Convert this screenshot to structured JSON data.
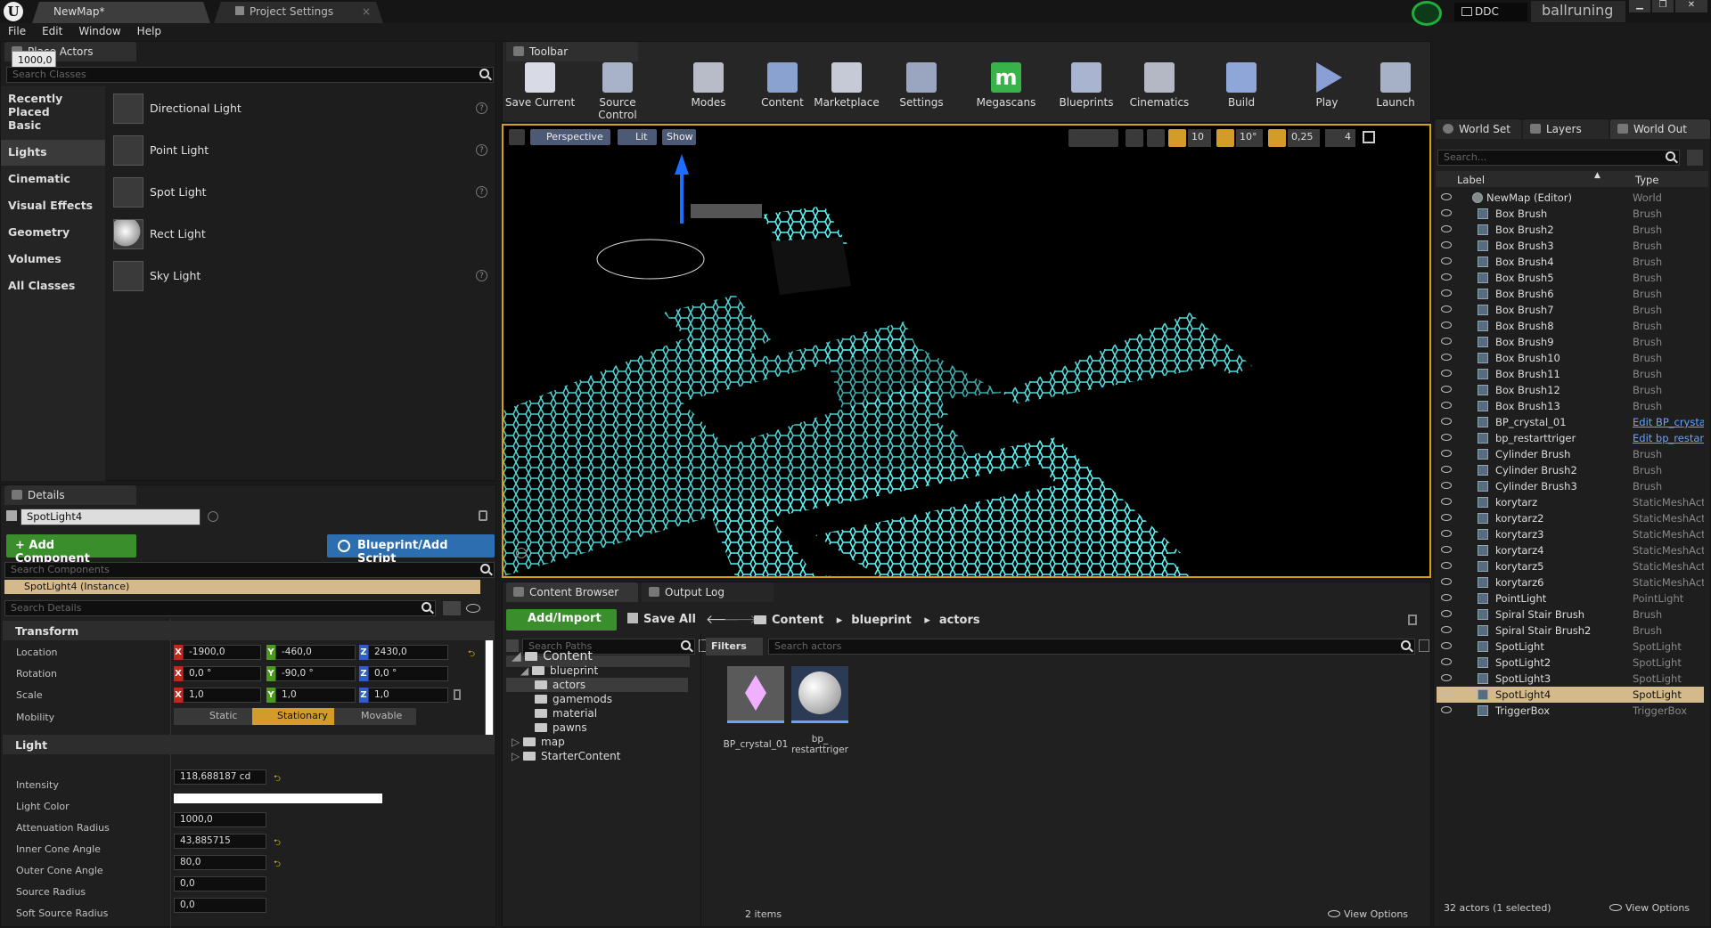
{
  "window": {
    "tabs": [
      {
        "label": "NewMap*"
      },
      {
        "label": "Project Settings"
      }
    ],
    "ddc_label": "DDC",
    "project_name": "ballruning"
  },
  "menu": [
    "File",
    "Edit",
    "Window",
    "Help"
  ],
  "place_actors": {
    "tab_label": "Place Actors",
    "tooltip": "1000,0",
    "search_placeholder": "Search Classes",
    "categories": [
      "Recently Placed",
      "Basic",
      "Lights",
      "Cinematic",
      "Visual Effects",
      "Geometry",
      "Volumes",
      "All Classes"
    ],
    "selected_category": "Lights",
    "items": [
      {
        "label": "Directional Light"
      },
      {
        "label": "Point Light"
      },
      {
        "label": "Spot Light"
      },
      {
        "label": "Rect Light"
      },
      {
        "label": "Sky Light"
      }
    ]
  },
  "details": {
    "tab_label": "Details",
    "actor_name": "SpotLight4",
    "add_component": "+ Add Component",
    "blueprint_button": "Blueprint/Add Script",
    "search_components_placeholder": "Search Components",
    "instance_label": "SpotLight4 (Instance)",
    "search_details_placeholder": "Search Details",
    "transform": {
      "title": "Transform",
      "location": {
        "label": "Location",
        "x": "-1900,0",
        "y": "-460,0",
        "z": "2430,0"
      },
      "rotation": {
        "label": "Rotation",
        "x": "0,0 °",
        "y": "-90,0 °",
        "z": "0,0 °"
      },
      "scale": {
        "label": "Scale",
        "x": "1,0",
        "y": "1,0",
        "z": "1,0"
      },
      "mobility": {
        "label": "Mobility",
        "options": [
          "Static",
          "Stationary",
          "Movable"
        ],
        "selected": "Stationary"
      }
    },
    "light": {
      "title": "Light",
      "intensity": {
        "label": "Intensity",
        "value": "118,688187 cd"
      },
      "light_color": {
        "label": "Light Color",
        "value": "#ffffff"
      },
      "attenuation_radius": {
        "label": "Attenuation Radius",
        "value": "1000,0"
      },
      "inner_cone_angle": {
        "label": "Inner Cone Angle",
        "value": "43,885715"
      },
      "outer_cone_angle": {
        "label": "Outer Cone Angle",
        "value": "80,0"
      },
      "source_radius": {
        "label": "Source Radius",
        "value": "0,0"
      },
      "soft_source_radius": {
        "label": "Soft Source Radius",
        "value": "0,0"
      }
    }
  },
  "toolbar": {
    "tab_label": "Toolbar",
    "buttons": [
      {
        "label": "Save Current"
      },
      {
        "label": "Source Control"
      },
      {
        "label": "Modes"
      },
      {
        "label": "Content"
      },
      {
        "label": "Marketplace"
      },
      {
        "label": "Settings"
      },
      {
        "label": "Megascans"
      },
      {
        "label": "Blueprints"
      },
      {
        "label": "Cinematics"
      },
      {
        "label": "Build"
      },
      {
        "label": "Play"
      },
      {
        "label": "Launch"
      }
    ]
  },
  "viewport": {
    "perspective": "Perspective",
    "lit": "Lit",
    "show": "Show",
    "grid_snap": "10",
    "rotation_snap": "10°",
    "scale_snap": "0,25",
    "camera_speed": "4",
    "floor_color": "#5ff2f2",
    "border_color": "#d4a017"
  },
  "outliner": {
    "tabs": [
      "World Set",
      "Layers",
      "World Out"
    ],
    "search_placeholder": "Search...",
    "col_label": "Label",
    "col_type": "Type",
    "root": {
      "label": "NewMap (Editor)",
      "type": "World"
    },
    "rows": [
      {
        "label": "Box Brush",
        "type": "Brush"
      },
      {
        "label": "Box Brush2",
        "type": "Brush"
      },
      {
        "label": "Box Brush3",
        "type": "Brush"
      },
      {
        "label": "Box Brush4",
        "type": "Brush"
      },
      {
        "label": "Box Brush5",
        "type": "Brush"
      },
      {
        "label": "Box Brush6",
        "type": "Brush"
      },
      {
        "label": "Box Brush7",
        "type": "Brush"
      },
      {
        "label": "Box Brush8",
        "type": "Brush"
      },
      {
        "label": "Box Brush9",
        "type": "Brush"
      },
      {
        "label": "Box Brush10",
        "type": "Brush"
      },
      {
        "label": "Box Brush11",
        "type": "Brush"
      },
      {
        "label": "Box Brush12",
        "type": "Brush"
      },
      {
        "label": "Box Brush13",
        "type": "Brush"
      },
      {
        "label": "BP_crystal_01",
        "type": "Edit BP_crysta"
      },
      {
        "label": "bp_restarttriger",
        "type": "Edit bp_restar"
      },
      {
        "label": "Cylinder Brush",
        "type": "Brush"
      },
      {
        "label": "Cylinder Brush2",
        "type": "Brush"
      },
      {
        "label": "Cylinder Brush3",
        "type": "Brush"
      },
      {
        "label": "korytarz",
        "type": "StaticMeshActo"
      },
      {
        "label": "korytarz2",
        "type": "StaticMeshActo"
      },
      {
        "label": "korytarz3",
        "type": "StaticMeshActo"
      },
      {
        "label": "korytarz4",
        "type": "StaticMeshActo"
      },
      {
        "label": "korytarz5",
        "type": "StaticMeshActo"
      },
      {
        "label": "korytarz6",
        "type": "StaticMeshActo"
      },
      {
        "label": "PointLight",
        "type": "PointLight"
      },
      {
        "label": "Spiral Stair Brush",
        "type": "Brush"
      },
      {
        "label": "Spiral Stair Brush2",
        "type": "Brush"
      },
      {
        "label": "SpotLight",
        "type": "SpotLight"
      },
      {
        "label": "SpotLight2",
        "type": "SpotLight"
      },
      {
        "label": "SpotLight3",
        "type": "SpotLight"
      },
      {
        "label": "SpotLight4",
        "type": "SpotLight"
      },
      {
        "label": "TriggerBox",
        "type": "TriggerBox"
      }
    ],
    "selected": "SpotLight4",
    "status": "32 actors (1 selected)",
    "view_options": "View Options"
  },
  "content_browser": {
    "tabs": [
      "Content Browser",
      "Output Log"
    ],
    "add_import": "Add/Import",
    "save_all": "Save All",
    "path": [
      "Content",
      "blueprint",
      "actors"
    ],
    "search_paths_placeholder": "Search Paths",
    "filters": "Filters",
    "search_actors_placeholder": "Search actors",
    "tree": [
      "Content",
      "blueprint",
      "actors",
      "gamemods",
      "material",
      "pawns",
      "map",
      "StarterContent"
    ],
    "assets": [
      {
        "label": "BP_crystal_01"
      },
      {
        "label": "bp_ restarttriger"
      }
    ],
    "items_count": "2 items",
    "view_options": "View Options"
  }
}
